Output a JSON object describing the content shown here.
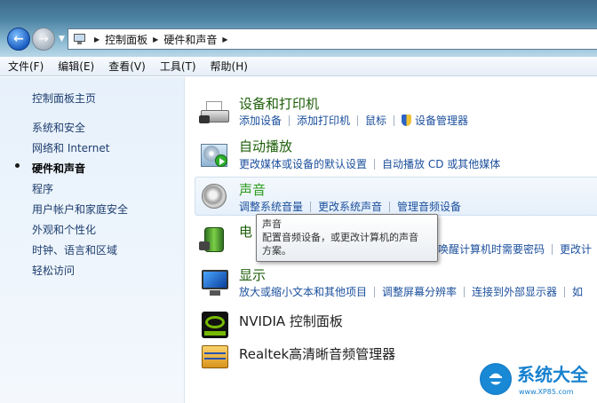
{
  "address": {
    "breadcrumb": [
      "控制面板",
      "硬件和声音"
    ]
  },
  "menu": [
    "文件(F)",
    "编辑(E)",
    "查看(V)",
    "工具(T)",
    "帮助(H)"
  ],
  "sidebar": {
    "home": "控制面板主页",
    "items": [
      "系统和安全",
      "网络和 Internet",
      "硬件和声音",
      "程序",
      "用户帐户和家庭安全",
      "外观和个性化",
      "时钟、语言和区域",
      "轻松访问"
    ],
    "active_index": 2
  },
  "categories": [
    {
      "title": "设备和打印机",
      "icon": "printer-icon",
      "links": [
        "添加设备",
        "添加打印机",
        "鼠标",
        "设备管理器"
      ]
    },
    {
      "title": "自动播放",
      "icon": "autoplay-icon",
      "links": [
        "更改媒体或设备的默认设置",
        "自动播放 CD 或其他媒体"
      ]
    },
    {
      "title": "声音",
      "icon": "speaker-icon",
      "links": [
        "调整系统音量",
        "更改系统声音",
        "管理音频设备"
      ]
    },
    {
      "title": "电",
      "icon": "power-icon",
      "links": [
        "唤醒计算机时需要密码",
        "更改计"
      ]
    },
    {
      "title": "显示",
      "icon": "display-icon",
      "links": [
        "放大或缩小文本和其他项目",
        "调整屏幕分辨率",
        "连接到外部显示器",
        "如"
      ]
    },
    {
      "title": "NVIDIA 控制面板",
      "icon": "nvidia-icon",
      "links": []
    },
    {
      "title": "Realtek高清晰音频管理器",
      "icon": "realtek-icon",
      "links": []
    }
  ],
  "tooltip": {
    "title": "声音",
    "text": "配置音频设备，或更改计算机的声音方案。",
    "line1": "配置音频设备，或更改计算机的声音",
    "line2": "方案。"
  },
  "watermark": {
    "brand": "系统大全",
    "url": "www.XP85.com"
  },
  "colors": {
    "link": "#1b4f9c",
    "category_title": "#1e5f0a",
    "sidebar_bg": "#e7f1fb"
  }
}
